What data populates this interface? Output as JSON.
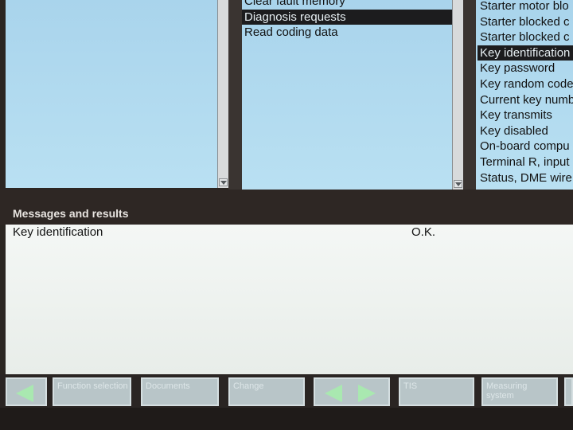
{
  "function_list": {
    "items": [
      {
        "label": "Clear fault memory",
        "selected": false
      },
      {
        "label": "Diagnosis requests",
        "selected": true
      },
      {
        "label": "Read coding data",
        "selected": false
      }
    ]
  },
  "request_list": {
    "items": [
      {
        "label": "Starter motor blo",
        "selected": false
      },
      {
        "label": "Starter blocked c",
        "selected": false
      },
      {
        "label": "Starter blocked c",
        "selected": false
      },
      {
        "label": "Key identification",
        "selected": true
      },
      {
        "label": "Key password",
        "selected": false
      },
      {
        "label": "Key random code",
        "selected": false
      },
      {
        "label": "Current key numb",
        "selected": false
      },
      {
        "label": "Key transmits",
        "selected": false
      },
      {
        "label": "Key disabled",
        "selected": false
      },
      {
        "label": "On-board compu",
        "selected": false
      },
      {
        "label": "Terminal R, input",
        "selected": false
      },
      {
        "label": "Status, DME wire",
        "selected": false
      }
    ]
  },
  "messages": {
    "title": "Messages and results",
    "rows": [
      {
        "name": "Key identification",
        "result": "O.K."
      }
    ]
  },
  "toolbar": {
    "function_selection": "Function selection",
    "btn2": "Documents",
    "btn3": "Change",
    "tis": "TIS",
    "measuring_system": "Measuring system"
  },
  "colors": {
    "pane_blue": "#b9e0f2",
    "selection": "#1c1c1e",
    "arrow_green": "#a9e8b0",
    "button_face": "#b8c5c8"
  }
}
